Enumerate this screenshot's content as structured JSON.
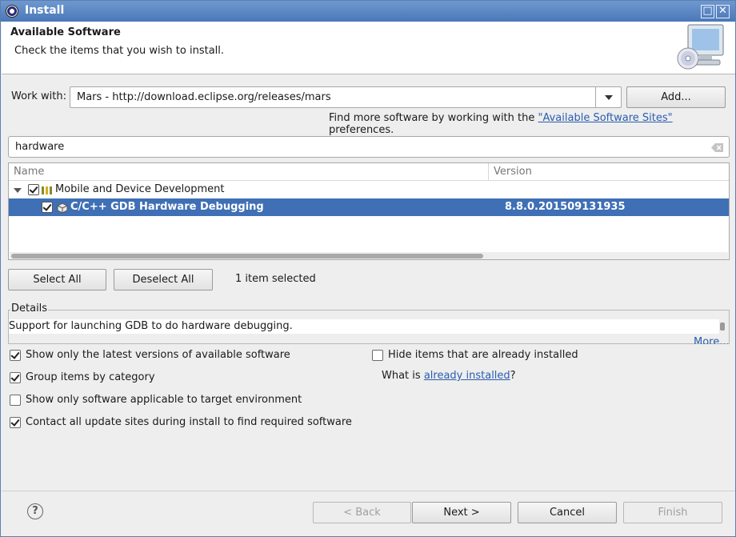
{
  "window": {
    "title": "Install"
  },
  "banner": {
    "heading": "Available Software",
    "subtitle": "Check the items that you wish to install."
  },
  "work_with": {
    "label": "Work with:",
    "value": "Mars - http://download.eclipse.org/releases/mars",
    "add_button": "Add...",
    "hint_prefix": "Find more software by working with the",
    "hint_link": "\"Available Software Sites\"",
    "hint_suffix": "preferences."
  },
  "filter": {
    "value": "hardware"
  },
  "tree": {
    "columns": [
      "Name",
      "Version"
    ],
    "rows": [
      {
        "label": "Mobile and Device Development",
        "version": "",
        "checked": true,
        "expanded": true,
        "selected": false
      },
      {
        "label": "C/C++ GDB Hardware Debugging",
        "version": "8.8.0.201509131935",
        "checked": true,
        "selected": true
      }
    ]
  },
  "selection": {
    "select_all": "Select All",
    "deselect_all": "Deselect All",
    "count_text": "1 item selected"
  },
  "details": {
    "legend": "Details",
    "text": "Support for launching GDB to do hardware debugging.",
    "more": "More..."
  },
  "options": {
    "latest_only": {
      "label": "Show only the latest versions of available software",
      "checked": true
    },
    "group_by_category": {
      "label": "Group items by category",
      "checked": true
    },
    "target_env": {
      "label": "Show only software applicable to target environment",
      "checked": false
    },
    "contact_sites": {
      "label": "Contact all update sites during install to find required software",
      "checked": true
    },
    "hide_installed": {
      "label": "Hide items that are already installed",
      "checked": false
    },
    "what_is_prefix": "What is",
    "what_is_link": "already installed",
    "what_is_suffix": "?"
  },
  "footer": {
    "help": "?",
    "back": "< Back",
    "next": "Next >",
    "cancel": "Cancel",
    "finish": "Finish"
  },
  "colors": {
    "selection": "#3f6fb5",
    "link": "#2a5db0",
    "titlebar": "#4a78b8"
  }
}
